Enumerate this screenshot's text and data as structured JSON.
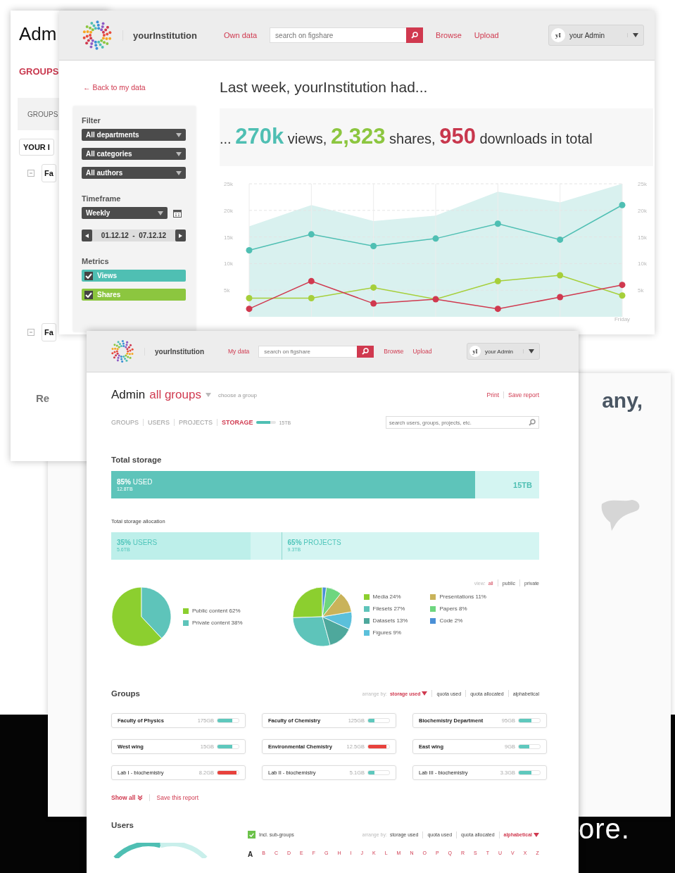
{
  "back_window": {
    "title": "Adm",
    "section": "GROUPS",
    "tab": "GROUPS",
    "button": "YOUR I",
    "rows": [
      "Fa",
      "Fa"
    ],
    "footer": "Re"
  },
  "analytics_window": {
    "header": {
      "brand": "yourInstitution",
      "data_link": "Own data",
      "search_placeholder": "search on figshare",
      "links": [
        "Browse",
        "Upload"
      ],
      "avatar": "yI",
      "user": "your Admin"
    },
    "back_link": "← Back to my data",
    "filter": {
      "heading": "Filter",
      "selects": [
        "All departments",
        "All categories",
        "All authors"
      ]
    },
    "timeframe": {
      "heading": "Timeframe",
      "select": "Weekly",
      "range": "01.12.12  -  07.12.12"
    },
    "metrics": {
      "heading": "Metrics",
      "items": [
        {
          "label": "Views",
          "checked": true,
          "color": "#4fbfb3"
        },
        {
          "label": "Shares",
          "checked": true,
          "color": "#8cc63f"
        }
      ]
    },
    "headline": "Last week, yourInstitution had...",
    "summary": [
      {
        "kind": "word",
        "text": "..."
      },
      {
        "kind": "figure",
        "text": "270k",
        "color": "#4fbfb3"
      },
      {
        "kind": "word",
        "text": "views,"
      },
      {
        "kind": "figure",
        "text": "2,323",
        "color": "#8cc63f"
      },
      {
        "kind": "word",
        "text": "shares,"
      },
      {
        "kind": "figure",
        "text": "950",
        "color": "#c8374d"
      },
      {
        "kind": "word",
        "text": "downloads in total"
      }
    ],
    "last_day_label": "Friday",
    "background_chart": {
      "chart_data": {
        "type": "area",
        "ylim": [
          0,
          25000
        ],
        "yticks": [
          {
            "value": 5000,
            "label": "5k"
          },
          {
            "value": 10000,
            "label": "10k"
          },
          {
            "value": 15000,
            "label": "15k"
          },
          {
            "value": 20000,
            "label": "20k"
          },
          {
            "value": 25000,
            "label": "25k"
          }
        ],
        "series": [
          {
            "color": "#d9f1ef",
            "values": [
              17000,
              21000,
              18000,
              19000,
              23500,
              21500,
              25000
            ]
          }
        ]
      }
    },
    "trend_chart": {
      "chart_data": {
        "type": "line",
        "grid": true,
        "ylim": [
          0,
          25000
        ],
        "yticks": [
          {
            "value": 5000,
            "label": "5k"
          },
          {
            "value": 10000,
            "label": "10k"
          },
          {
            "value": 15000,
            "label": "15k"
          },
          {
            "value": 20000,
            "label": "20k"
          },
          {
            "value": 25000,
            "label": "25k"
          }
        ],
        "series": [
          {
            "color": "#4fbfb3",
            "marker": "circle",
            "values": [
              12500,
              15500,
              13300,
              14700,
              17500,
              14500,
              21000
            ]
          },
          {
            "color": "#a6cf3a",
            "marker": "circle",
            "values": [
              3500,
              3500,
              5500,
              3300,
              6700,
              7800,
              4000
            ]
          },
          {
            "color": "#d0394f",
            "marker": "circle",
            "values": [
              1500,
              6700,
              2500,
              3300,
              1500,
              3700,
              6000
            ]
          }
        ]
      }
    }
  },
  "promo": {
    "text": "any,",
    "tagline": "ore."
  },
  "admin_window": {
    "header": {
      "brand": "yourInstitution",
      "data_link": "My data",
      "search_placeholder": "search on figshare",
      "links": [
        "Browse",
        "Upload"
      ],
      "avatar": "yI",
      "user": "your Admin"
    },
    "title": "Admin",
    "title_accent": "all groups",
    "group_hint": "choose a group",
    "actions": [
      "Print",
      "Save report"
    ],
    "tabs": [
      {
        "label": "GROUPS",
        "selected": false
      },
      {
        "label": "USERS",
        "selected": false
      },
      {
        "label": "PROJECTS",
        "selected": false
      },
      {
        "label": "STORAGE",
        "selected": true
      }
    ],
    "storage_meter": {
      "level": 0.7,
      "reading": "15TB"
    },
    "search_placeholder": "search users, groups, projects, etc.",
    "total_storage": {
      "heading": "Total storage",
      "level": 0.85,
      "percent": "85%",
      "label": "USED",
      "amount": "12.8TB",
      "capacity": "15TB"
    },
    "allocation": {
      "heading": "Total storage allocation",
      "segments": [
        {
          "percent": "35%",
          "label": "USERS",
          "amount": "5.6TB",
          "level": 0.35
        },
        {
          "percent": "65%",
          "label": "PROJECTS",
          "amount": "9.3TB",
          "level": 0.65
        }
      ]
    },
    "view_filter": {
      "label": "view:",
      "options": [
        {
          "label": "all",
          "selected": true
        },
        {
          "label": "public",
          "selected": false
        },
        {
          "label": "private",
          "selected": false
        }
      ]
    },
    "pies": [
      {
        "slices": [
          {
            "color": "#8ccf2f"
          },
          {
            "color": "#5ec4ba"
          }
        ],
        "chart_data": {
          "type": "pie",
          "categories": [
            "Public content 62%",
            "Private content 38%"
          ],
          "series": [
            {
              "values": [
                62,
                38
              ]
            }
          ]
        }
      },
      {
        "slices": [
          {
            "color": "#8ccf2f"
          },
          {
            "color": "#5ec4ba"
          },
          {
            "color": "#4ea89c"
          },
          {
            "color": "#5bc0db"
          },
          {
            "color": "#c9b35a"
          },
          {
            "color": "#6ed67f"
          },
          {
            "color": "#4a8fd6"
          }
        ],
        "chart_data": {
          "type": "pie",
          "categories": [
            "Media 24%",
            "Filesets 27%",
            "Datasets 13%",
            "Figures 9%",
            "Presentations 11%",
            "Papers 8%",
            "Code 2%"
          ],
          "series": [
            {
              "values": [
                24,
                27,
                13,
                9,
                11,
                8,
                2
              ]
            }
          ]
        }
      }
    ],
    "groups": {
      "heading": "Groups",
      "arrange_label": "arrange by:",
      "sort_options": [
        {
          "label": "storage used",
          "selected": true
        },
        {
          "label": "quota used",
          "selected": false
        },
        {
          "label": "quota allocated",
          "selected": false
        },
        {
          "label": "alphabetical",
          "selected": false
        }
      ],
      "items": [
        {
          "name": "Faculty of Physics",
          "bold": true,
          "size": "175GB",
          "level": 0.7,
          "color": "#5ec8bd"
        },
        {
          "name": "Faculty of Chemistry",
          "bold": true,
          "size": "125GB",
          "level": 0.3,
          "color": "#5ec8bd"
        },
        {
          "name": "Biochemistry Department",
          "bold": true,
          "size": "95GB",
          "level": 0.6,
          "color": "#5ec8bd"
        },
        {
          "name": "West wing",
          "bold": true,
          "size": "15GB",
          "level": 0.7,
          "color": "#5ec8bd"
        },
        {
          "name": "Environmental Chemistry",
          "bold": true,
          "size": "12.5GB",
          "level": 0.85,
          "color": "#e8413c"
        },
        {
          "name": "East wing",
          "bold": true,
          "size": "9GB",
          "level": 0.5,
          "color": "#5ec8bd"
        },
        {
          "name": "Lab I - biochemistry",
          "bold": false,
          "size": "8.2GB",
          "level": 0.9,
          "color": "#e8413c"
        },
        {
          "name": "Lab II - biochemistry",
          "bold": false,
          "size": "5.1GB",
          "level": 0.3,
          "color": "#5ec8bd"
        },
        {
          "name": "Lab III - biochemistry",
          "bold": false,
          "size": "3.3GB",
          "level": 0.6,
          "color": "#5ec8bd"
        }
      ],
      "show_all": "Show all",
      "save": "Save this report"
    },
    "users": {
      "heading": "Users",
      "include_subgroups": {
        "label": "Incl. sub-groups",
        "checked": true
      },
      "arrange_label": "arrange by:",
      "sort_options": [
        {
          "label": "storage used",
          "selected": false
        },
        {
          "label": "quota used",
          "selected": false
        },
        {
          "label": "quota allocated",
          "selected": false
        },
        {
          "label": "alphabetical",
          "selected": true
        }
      ],
      "letters": [
        {
          "label": "A",
          "selected": true
        },
        {
          "label": "B",
          "selected": false
        },
        {
          "label": "C",
          "selected": false
        },
        {
          "label": "D",
          "selected": false
        },
        {
          "label": "E",
          "selected": false
        },
        {
          "label": "F",
          "selected": false
        },
        {
          "label": "G",
          "selected": false
        },
        {
          "label": "H",
          "selected": false
        },
        {
          "label": "I",
          "selected": false
        },
        {
          "label": "J",
          "selected": false
        },
        {
          "label": "K",
          "selected": false
        },
        {
          "label": "L",
          "selected": false
        },
        {
          "label": "M",
          "selected": false
        },
        {
          "label": "N",
          "selected": false
        },
        {
          "label": "O",
          "selected": false
        },
        {
          "label": "P",
          "selected": false
        },
        {
          "label": "Q",
          "selected": false
        },
        {
          "label": "R",
          "selected": false
        },
        {
          "label": "S",
          "selected": false
        },
        {
          "label": "T",
          "selected": false
        },
        {
          "label": "U",
          "selected": false
        },
        {
          "label": "V",
          "selected": false
        },
        {
          "label": "X",
          "selected": false
        },
        {
          "label": "Z",
          "selected": false
        }
      ]
    }
  }
}
